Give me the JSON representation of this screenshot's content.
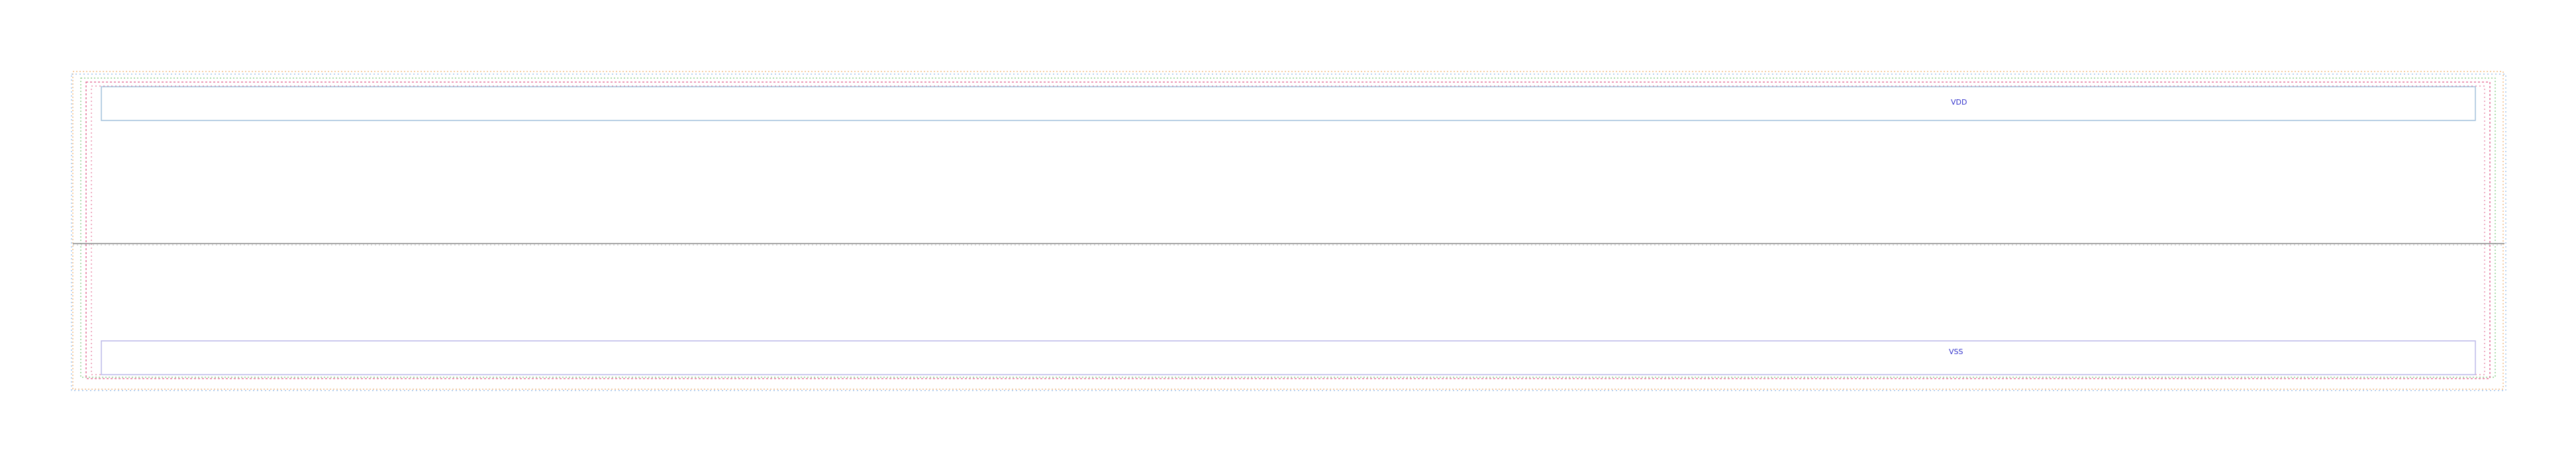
{
  "layout": {
    "pins": [
      {
        "name": "VDD",
        "color": "#3333cc"
      },
      {
        "name": "VSS",
        "color": "#3333cc"
      }
    ],
    "colors": {
      "background": "#ffffff",
      "outer_boundary_orange": "#f0b070",
      "outer_boundary_blue": "#8fb8e8",
      "nwell_boundary_red": "#e05c8a",
      "inner_boundary_green": "#7cc87c",
      "rail_outline": "#9bbcd8",
      "center_line": "#8a8a8a",
      "pin_text": "#3333cc"
    }
  }
}
